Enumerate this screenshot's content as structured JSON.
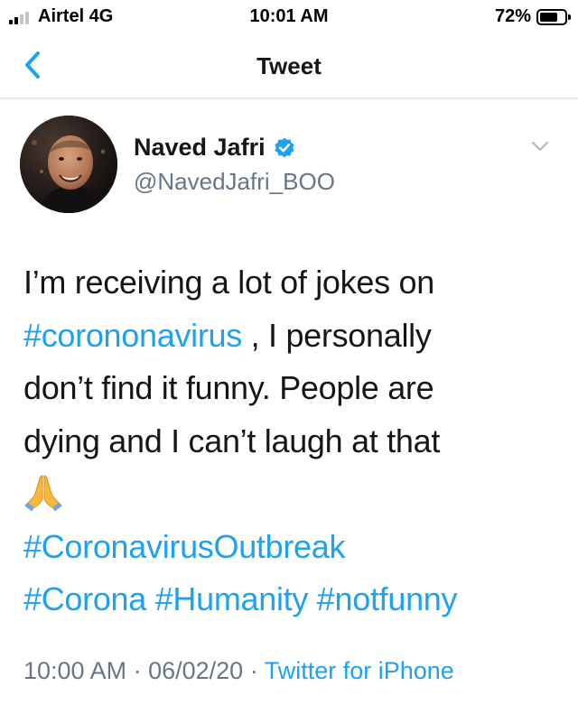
{
  "status_bar": {
    "carrier": "Airtel 4G",
    "time": "10:01 AM",
    "battery_percent": "72%",
    "battery_level": 0.72
  },
  "nav": {
    "title": "Tweet",
    "back_icon": "chevron-left-icon"
  },
  "tweet": {
    "author": {
      "display_name": "Naved Jafri",
      "handle": "@NavedJafri_BOO",
      "verified": true
    },
    "lines": {
      "l1": "I’m receiving a lot of jokes on",
      "l2_tag": "#corononavirus",
      "l2_rest": " , I personally",
      "l3": "don’t find it funny. People are",
      "l4": "dying and I can’t laugh at that",
      "emoji": "folded-hands-emoji",
      "tag_outbreak": "#CoronavirusOutbreak",
      "tag_corona": "#Corona",
      "tag_humanity": "#Humanity",
      "tag_notfunny": "#notfunny"
    },
    "meta": {
      "time": "10:00 AM",
      "separator": " · ",
      "date": "06/02/20",
      "source": "Twitter for iPhone"
    }
  },
  "colors": {
    "link": "#1da1f2",
    "text": "#14171a",
    "secondary": "#657786",
    "divider": "#e1e8ed"
  }
}
